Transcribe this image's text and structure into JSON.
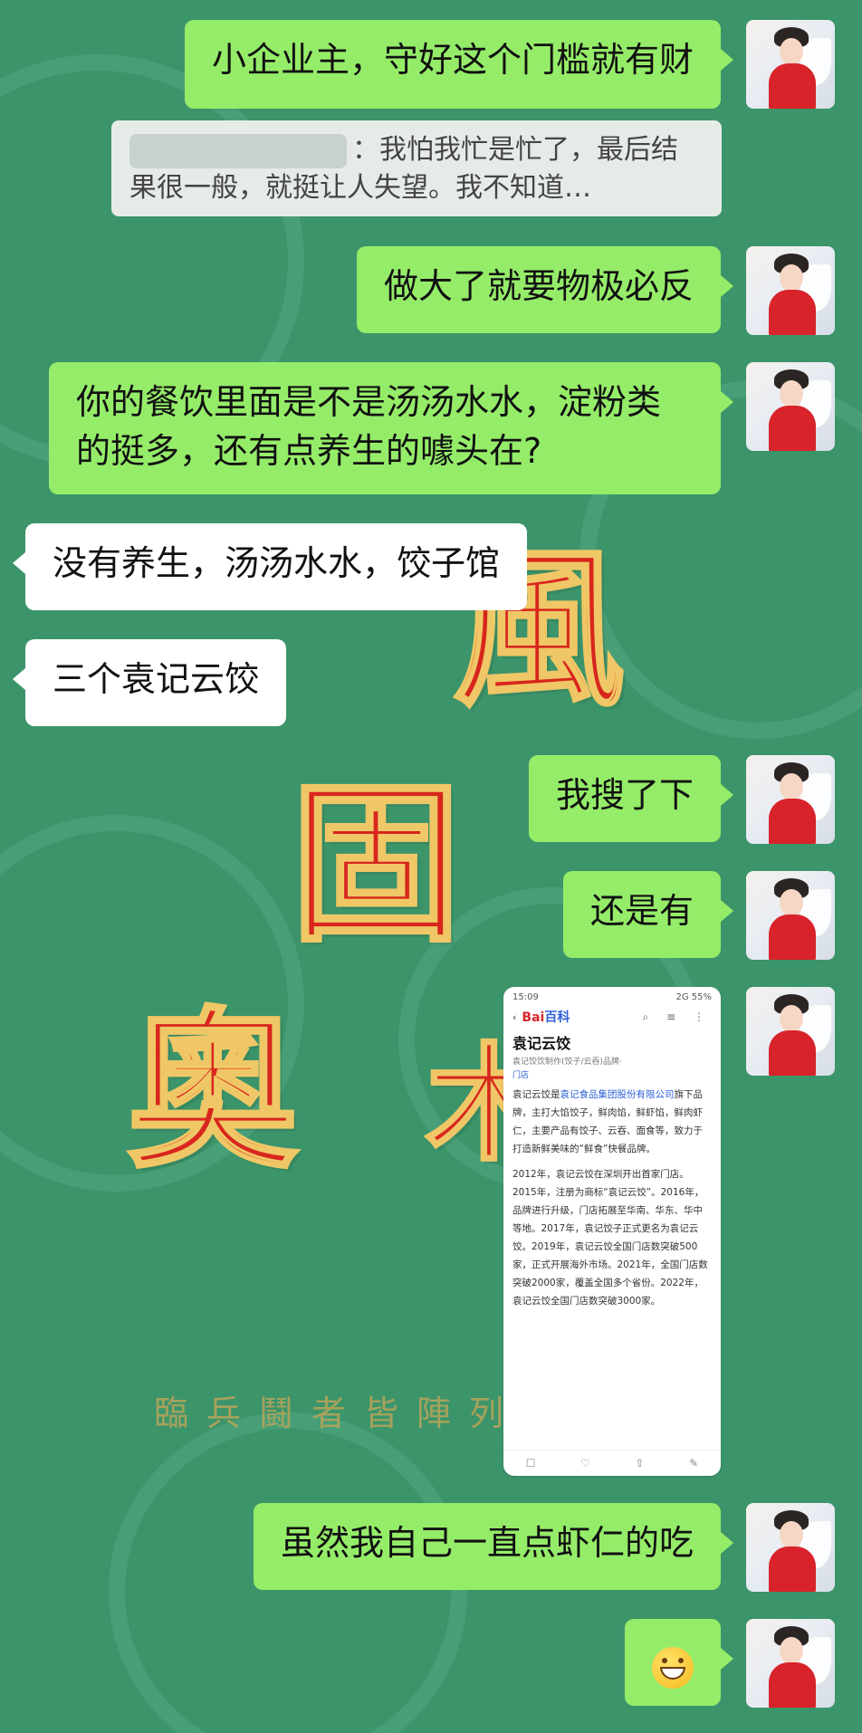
{
  "background": {
    "glyphs": [
      "風",
      "固",
      "奧",
      "木"
    ],
    "poem": "臨兵鬪者皆陣列"
  },
  "messages": [
    {
      "id": "m1",
      "side": "me",
      "text": "小企业主，守好这个门槛就有财"
    },
    {
      "id": "q1",
      "side": "quote",
      "text": "：我怕我忙是忙了，最后结果很一般，就挺让人失望。我不知道…"
    },
    {
      "id": "m2",
      "side": "me",
      "text": "做大了就要物极必反"
    },
    {
      "id": "m3",
      "side": "me",
      "text": "你的餐饮里面是不是汤汤水水，淀粉类的挺多，还有点养生的噱头在?"
    },
    {
      "id": "m4",
      "side": "them",
      "text": "没有养生，汤汤水水，饺子馆"
    },
    {
      "id": "m5",
      "side": "them",
      "text": "三个袁记云饺"
    },
    {
      "id": "m6",
      "side": "me",
      "text": "我搜了下"
    },
    {
      "id": "m7",
      "side": "me",
      "text": "还是有"
    },
    {
      "id": "m8",
      "side": "me",
      "type": "image"
    },
    {
      "id": "m9",
      "side": "me",
      "text": "虽然我自己一直点虾仁的吃"
    },
    {
      "id": "m10",
      "side": "me",
      "type": "emoji",
      "icon": "grinning-face-icon"
    }
  ],
  "screenshot": {
    "time": "15:09",
    "right_status": "2G 55%",
    "logo_a": "Bai",
    "logo_b": "百科",
    "title": "袁记云饺",
    "subtitle": "袁记饺饮制作(饺子/云吞)品牌·",
    "tag": "门店",
    "para1_a": "袁记云饺是",
    "para1_link": "袁记食品集团股份有限公司",
    "para1_b": "旗下品牌，主打大馅饺子，鲜肉馅，鲜虾馅，鲜肉虾仁，主要产品有饺子、云吞、面食等，致力于打造新鲜美味的“鲜食”快餐品牌。",
    "para2": "2012年，袁记云饺在深圳开出首家门店。2015年，注册为商标“袁记云饺”。2016年，品牌进行升级，门店拓展至华南、华东、华中等地。2017年，袁记饺子正式更名为袁记云饺。2019年，袁记云饺全国门店数突破500家，正式开展海外市场。2021年，全国门店数突破2000家，覆盖全国多个省份。2022年，袁记云饺全国门店数突破3000家。"
  },
  "colors": {
    "bg": "#3c946a",
    "me_bubble": "#95ec69",
    "them_bubble": "#ffffff",
    "glyph_red": "#d8261e"
  }
}
